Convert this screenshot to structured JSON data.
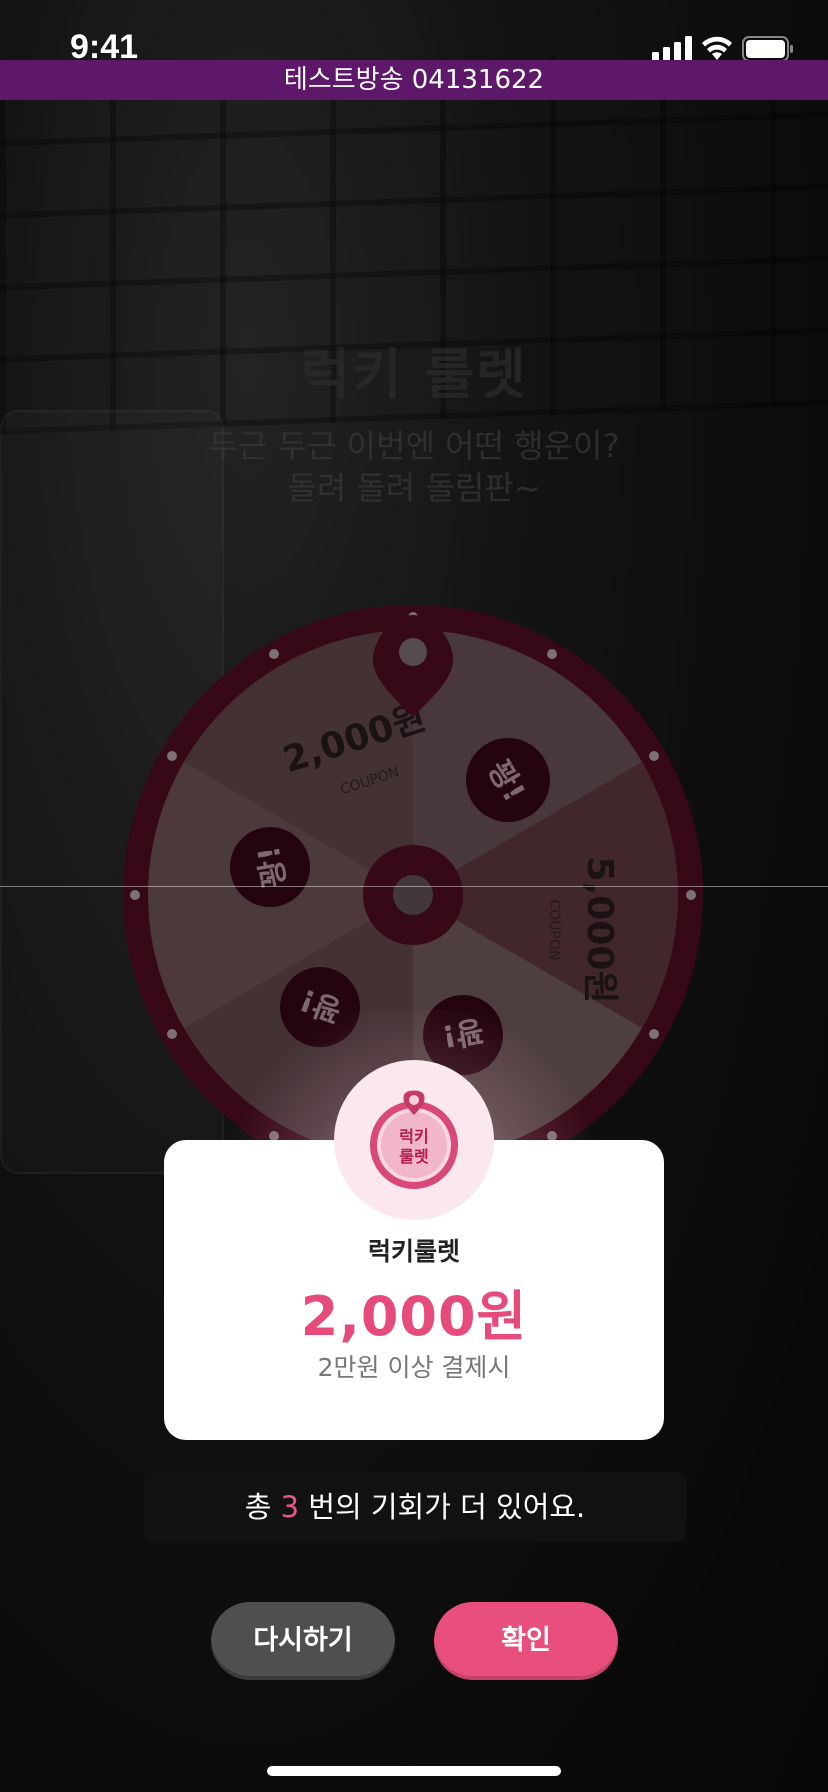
{
  "status_bar": {
    "time": "9:41"
  },
  "banner": {
    "text": "테스트방송 04131622"
  },
  "header": {
    "title": "럭키 룰렛",
    "subtitle_line1": "두근 두근 이번엔 어떤 행운이?",
    "subtitle_line2": "돌려 돌려 돌림판~"
  },
  "wheel": {
    "segments": [
      {
        "amount": "2,000원",
        "sub": "COUPON"
      },
      {
        "bomb": "꽝!"
      },
      {
        "amount": "5,000원",
        "sub": "COUPON"
      },
      {
        "bomb": "꽝!"
      },
      {
        "bomb": "꽝!"
      },
      {
        "bomb": "꽝!"
      }
    ]
  },
  "result": {
    "badge_text_line1": "럭키",
    "badge_text_line2": "룰렛",
    "label": "럭키룰렛",
    "amount": "2,000원",
    "condition": "2만원 이상 결제시"
  },
  "chances": {
    "prefix": "총",
    "count": "3",
    "suffix": "번의 기회가 더 있어요."
  },
  "buttons": {
    "retry": "다시하기",
    "confirm": "확인"
  },
  "colors": {
    "accent": "#e94f7d",
    "banner": "#5d1869",
    "wheel_rim": "#5a0d25"
  }
}
